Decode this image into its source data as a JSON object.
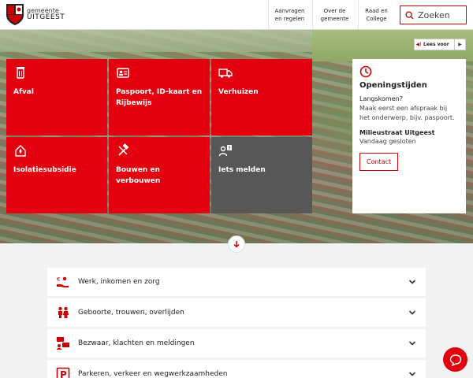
{
  "header": {
    "logo_small": "gemeente",
    "logo_big": "UITGEEST",
    "nav": [
      {
        "line1": "Aanvragen",
        "line2": "en regelen"
      },
      {
        "line1": "Over de",
        "line2": "gemeente"
      },
      {
        "line1": "Raad en",
        "line2": "College"
      }
    ],
    "search_placeholder": "Zoeken"
  },
  "readspeaker": {
    "label": "Lees voor"
  },
  "tiles": [
    {
      "label": "Afval",
      "icon": "trash-bin-icon"
    },
    {
      "label": "Paspoort, ID-kaart en Rijbewijs",
      "icon": "id-card-icon"
    },
    {
      "label": "Verhuizen",
      "icon": "moving-truck-icon"
    },
    {
      "label": "Isolatiesubsidie",
      "icon": "house-insulation-icon"
    },
    {
      "label": "Bouwen en verbouwen",
      "icon": "hammer-icon"
    },
    {
      "label": "Iets melden",
      "icon": "report-person-icon"
    }
  ],
  "hours": {
    "title": "Openingstijden",
    "subtitle": "Langskomen?",
    "text": "Maak eerst een afspraak bij het onderwerp, bijv. paspoort.",
    "subtitle2": "Milieustraat Uitgeest",
    "status": "Vandaag gesloten",
    "button": "Contact"
  },
  "accordion": [
    {
      "label": "Werk, inkomen en zorg",
      "icon": "money-hand-icon"
    },
    {
      "label": "Geboorte, trouwen, overlijden",
      "icon": "family-icon"
    },
    {
      "label": "Bezwaar, klachten en meldingen",
      "icon": "complaint-icon"
    },
    {
      "label": "Parkeren, verkeer en wegwerkzaamheden",
      "icon": "parking-icon"
    }
  ],
  "colors": {
    "brand_red": "#e3000f",
    "tile_grey": "#575757"
  }
}
